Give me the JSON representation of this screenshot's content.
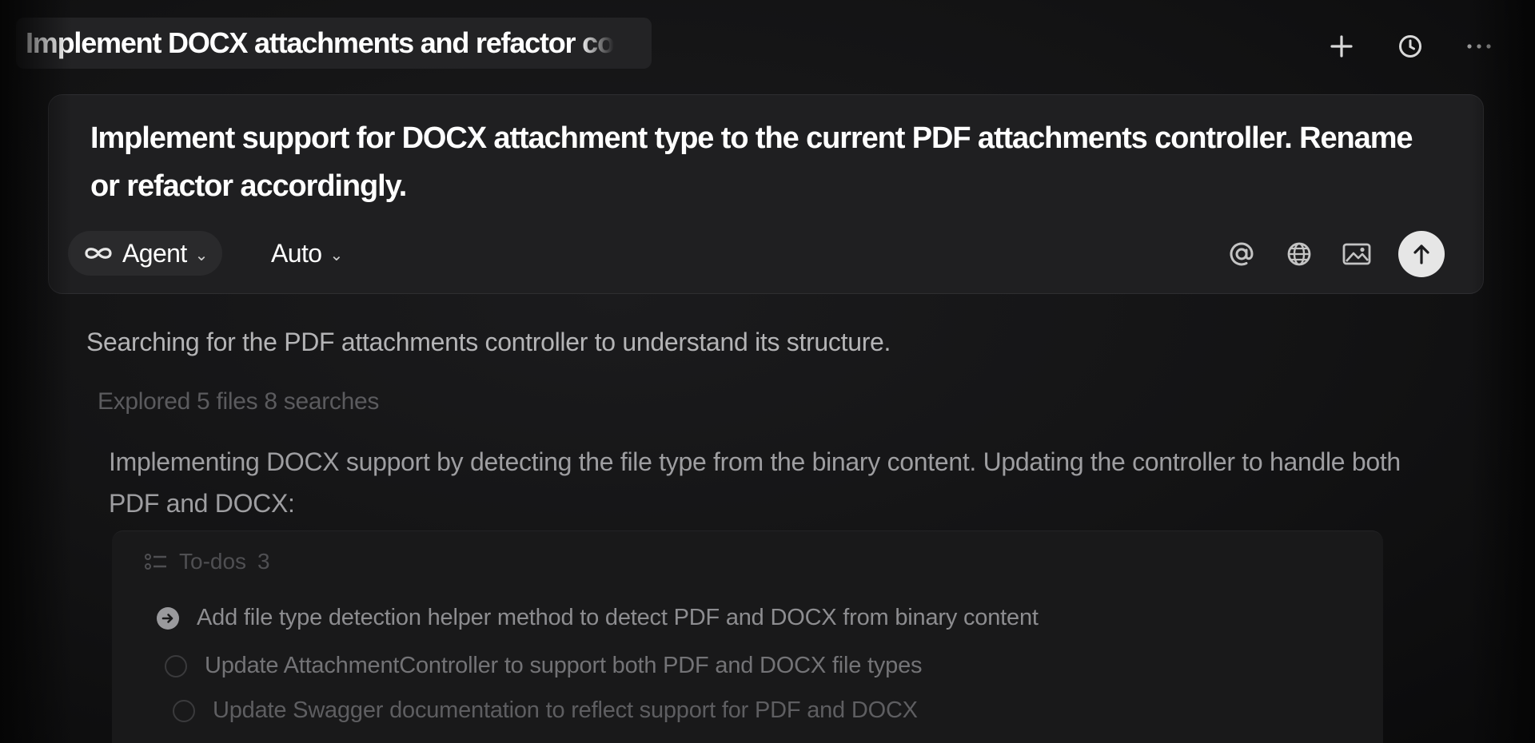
{
  "header": {
    "chat_title": "Implement DOCX attachments and refactor co",
    "actions": [
      {
        "name": "new-chat-button",
        "icon": "plus-icon"
      },
      {
        "name": "history-button",
        "icon": "clock-icon"
      },
      {
        "name": "more-button",
        "icon": "ellipsis-icon"
      }
    ]
  },
  "prompt": {
    "text": "Implement support for DOCX attachment type to the current PDF attachments controller. Rename or refactor accordingly.",
    "mode_label": "Agent",
    "mode_icon": "infinity-icon",
    "model_label": "Auto",
    "tools": [
      "at-mention-icon",
      "globe-icon",
      "image-icon"
    ],
    "send_icon": "arrow-up-icon"
  },
  "conversation": {
    "message_1": "Searching for the PDF attachments controller to understand its structure.",
    "explored_summary": "Explored 5 files 8 searches",
    "message_2": "Implementing DOCX support by detecting the file type from the binary content. Updating the controller to handle both PDF and DOCX:",
    "todos": {
      "title": "To-dos",
      "count": "3",
      "items": [
        {
          "label": "Add file type detection helper method to detect PDF and DOCX from binary content",
          "status": "in-progress"
        },
        {
          "label": "Update AttachmentController to support both PDF and DOCX file types",
          "status": "pending"
        },
        {
          "label": "Update Swagger documentation to reflect support for PDF and DOCX",
          "status": "pending"
        }
      ]
    }
  },
  "colors": {
    "background": "#131314",
    "card": "#1f1f21",
    "text_primary": "#ffffff",
    "text_muted": "#a9a9ab"
  }
}
